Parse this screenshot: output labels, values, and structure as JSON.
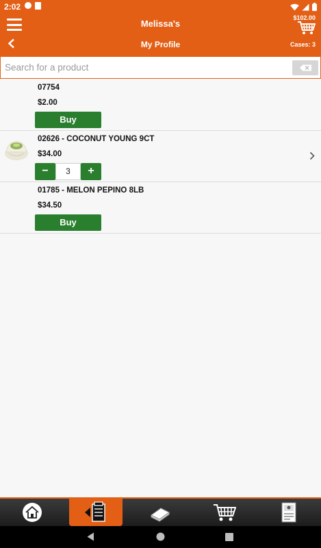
{
  "status_bar": {
    "time": "2:02"
  },
  "header": {
    "store_name": "Melissa's",
    "cart_total": "$102.00",
    "page_title": "My Profile",
    "cases": "Cases: 3"
  },
  "search": {
    "placeholder": "Search for a product",
    "value": ""
  },
  "products": [
    {
      "sku": "07754",
      "price": "$2.00",
      "button": "Buy"
    },
    {
      "sku": "02626 - COCONUT YOUNG 9CT",
      "price": "$34.00",
      "quantity": "3",
      "minus": "−",
      "plus": "+"
    },
    {
      "sku": "01785 - MELON PEPINO 8LB",
      "price": "$34.50",
      "button": "Buy"
    }
  ],
  "colors": {
    "accent": "#e35f16",
    "buy_green": "#2a7f2e"
  },
  "bottom_nav": {
    "active": "order-guide",
    "icons": [
      "home-icon",
      "order-guide-icon",
      "catalog-icon",
      "cart-icon",
      "account-icon"
    ]
  }
}
